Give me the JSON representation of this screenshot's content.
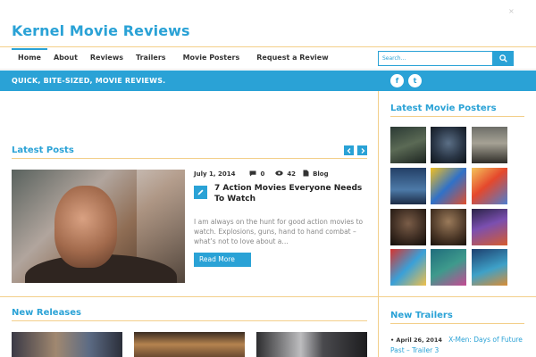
{
  "site": {
    "title": "Kernel Movie Reviews",
    "close_glyph": "×"
  },
  "nav": {
    "items": [
      {
        "label": "Home",
        "active": true
      },
      {
        "label": "About"
      },
      {
        "label": "Reviews"
      },
      {
        "label": "Trailers"
      },
      {
        "label": "Movie Posters"
      },
      {
        "label": "Request a Review"
      }
    ]
  },
  "search": {
    "placeholder": "Search..."
  },
  "tagline": "QUICK, BITE-SIZED, MOVIE REVIEWS.",
  "social": {
    "facebook_glyph": "f",
    "twitter_glyph": "t"
  },
  "latest_posts": {
    "heading": "Latest Posts",
    "post": {
      "date": "July 1, 2014",
      "comments": "0",
      "views": "42",
      "category": "Blog",
      "title": "7 Action Movies Everyone Needs To Watch",
      "excerpt": "I am always on the hunt for good action movies to watch. Explosions, guns, hand to hand combat – what’s not to love about a…",
      "read_more": "Read More"
    }
  },
  "latest_posters": {
    "heading": "Latest Movie Posters"
  },
  "new_releases": {
    "heading": "New Releases"
  },
  "new_trailers": {
    "heading": "New Trailers",
    "items": [
      {
        "date": "April 26, 2014",
        "title": "X-Men: Days of Future Past – Trailer 3"
      }
    ]
  },
  "colors": {
    "accent": "#2aa2d6",
    "rule": "#f3cf8a"
  }
}
